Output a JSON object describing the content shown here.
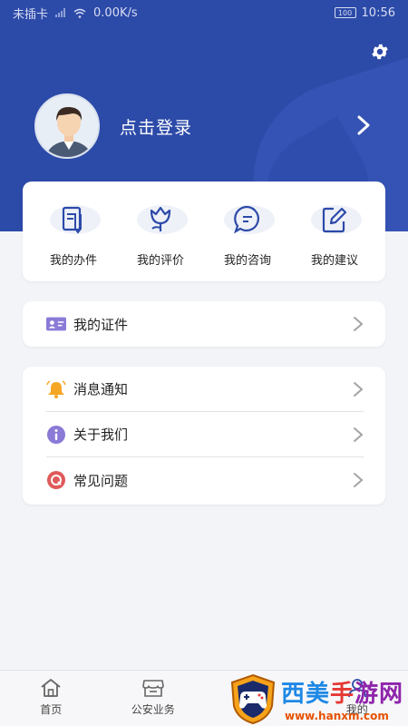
{
  "status_bar": {
    "carrier": "未插卡",
    "network_speed": "0.00K/s",
    "battery": "100",
    "time": "10:56"
  },
  "header": {
    "login_text": "点击登录"
  },
  "quick_actions": [
    {
      "label": "我的办件",
      "icon": "document-edit-icon"
    },
    {
      "label": "我的评价",
      "icon": "flower-icon"
    },
    {
      "label": "我的咨询",
      "icon": "chat-bubble-icon"
    },
    {
      "label": "我的建议",
      "icon": "pencil-square-icon"
    }
  ],
  "certificates": {
    "label": "我的证件",
    "icon": "id-card-icon"
  },
  "menu": [
    {
      "label": "消息通知",
      "icon": "bell-icon"
    },
    {
      "label": "关于我们",
      "icon": "info-icon"
    },
    {
      "label": "常见问题",
      "icon": "question-icon"
    }
  ],
  "tabbar": [
    {
      "label": "首页",
      "icon": "home-icon"
    },
    {
      "label": "公安业务",
      "icon": "store-icon"
    },
    {
      "label": "",
      "icon": "service-icon"
    },
    {
      "label": "我的",
      "icon": "user-icon"
    }
  ],
  "watermark": {
    "title_1": "西美",
    "title_2": "手",
    "title_3": "游网",
    "url": "www.hanxm.com"
  },
  "colors": {
    "header_blue": "#2c4aa8",
    "icon_blue": "#2c4aa8",
    "bell_orange": "#f5a623",
    "info_purple": "#8b7ad6",
    "question_red": "#e05a5a"
  }
}
